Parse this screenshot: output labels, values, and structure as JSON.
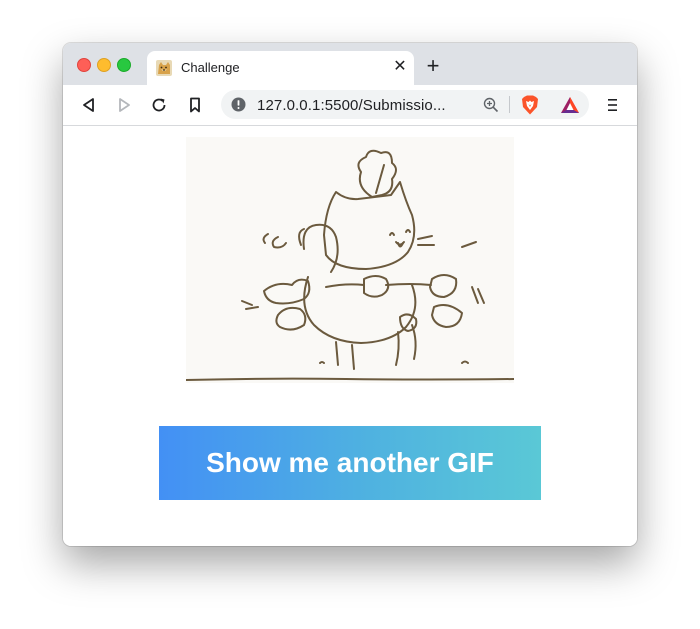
{
  "browser": {
    "tab": {
      "title": "Challenge",
      "close_glyph": "✕",
      "favicon": "doge-favicon"
    },
    "new_tab_glyph": "+",
    "address_bar": {
      "url": "127.0.0.1:5500/Submissio..."
    },
    "toolbar_icons": [
      "back-icon",
      "forward-icon",
      "reload-icon",
      "bookmark-icon",
      "info-icon",
      "zoom-icon",
      "brave-shield-icon",
      "bat-rewards-icon",
      "menu-icon"
    ]
  },
  "page": {
    "gif": {
      "description_icon": "cartoon-cat-gif"
    },
    "button_label": "Show me another GIF"
  },
  "colors": {
    "gradient_start": "#4390f5",
    "gradient_end": "#5ac8d6",
    "tabstrip": "#dee1e6"
  }
}
